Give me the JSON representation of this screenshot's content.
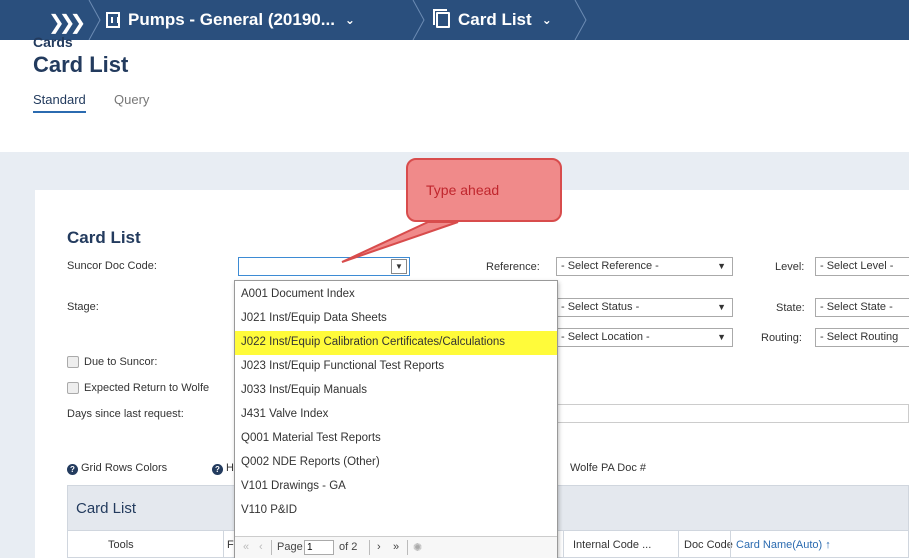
{
  "topbar": {
    "project": "Pumps - General (20190...",
    "page": "Card List"
  },
  "header": {
    "crumb": "Cards",
    "title": "Card List",
    "tabs": [
      {
        "label": "Standard"
      },
      {
        "label": "Query"
      }
    ]
  },
  "callout": {
    "text": "Type ahead"
  },
  "form": {
    "section_title": "Card List",
    "doc_code_label": "Suncor Doc Code:",
    "doc_code_value": "",
    "reference_label": "Reference:",
    "reference_value": "- Select Reference -",
    "level_label": "Level:",
    "level_value": "- Select Level -",
    "stage_label": "Stage:",
    "status_value": "- Select Status -",
    "state_label": "State:",
    "state_value": "- Select State -",
    "location_value": "- Select Location -",
    "routing_label": "Routing:",
    "routing_value": "- Select Routing",
    "due_label": "Due to Suncor:",
    "expected_label": "Expected Return to Wolfe",
    "days_label": "Days since last request:"
  },
  "dropdown": {
    "items": [
      {
        "label": "A001 Document Index"
      },
      {
        "label": "J021 Inst/Equip Data Sheets"
      },
      {
        "label": "J022 Inst/Equip Calibration Certificates/Calculations"
      },
      {
        "label": "J023 Inst/Equip Functional Test Reports"
      },
      {
        "label": "J033 Inst/Equip Manuals"
      },
      {
        "label": "J431 Valve Index"
      },
      {
        "label": "Q001 Material Test Reports"
      },
      {
        "label": "Q002 NDE Reports (Other)"
      },
      {
        "label": "V101 Drawings - GA"
      },
      {
        "label": "V110 P&ID"
      }
    ],
    "highlighted_index": 2,
    "highlight_color": "#fffb3a",
    "pager": {
      "page_label": "Page",
      "page_value": "1",
      "of_label": "of 2"
    }
  },
  "grid": {
    "links": [
      {
        "label": "Grid Rows Colors"
      },
      {
        "label": "H"
      },
      {
        "label": "Wolfe PA Doc #"
      }
    ],
    "title": "Card List",
    "columns": [
      {
        "label": "Tools"
      },
      {
        "label": "F"
      },
      {
        "label": "Internal Code ..."
      },
      {
        "label": "Doc Code"
      },
      {
        "label": "Card Name(Auto)"
      }
    ]
  },
  "colors": {
    "topbar": "#2a4f7d",
    "accent": "#2b6bb0",
    "title": "#233b5e",
    "callout_fill": "#f08a8a",
    "callout_stroke": "#d84c4c"
  }
}
